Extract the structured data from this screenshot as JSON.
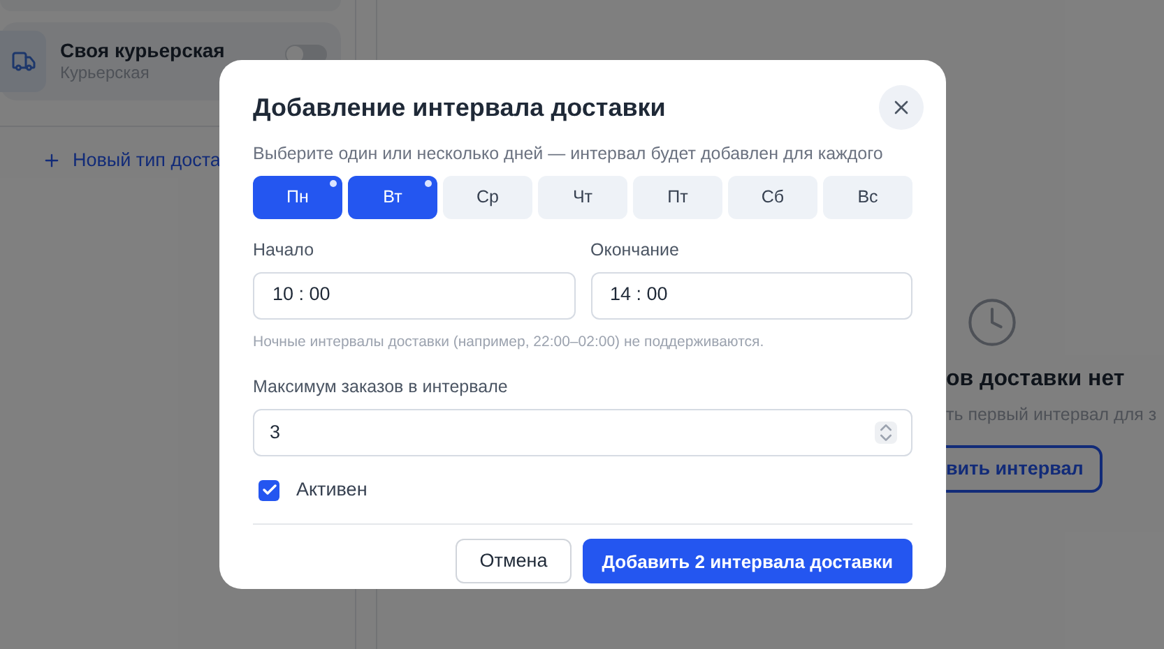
{
  "sidebar": {
    "items": [
      {
        "title": "Своя курьерская",
        "subtitle": "Курьерская",
        "on": false
      }
    ],
    "add_link": "Новый тип доста"
  },
  "empty_state": {
    "title": "ов доставки нет",
    "subtitle": "ть первый интервал для з",
    "button": "вить интервал"
  },
  "dialog": {
    "title": "Добавление интервала доставки",
    "hint": "Выберите один или несколько дней — интервал будет добавлен для каждого",
    "days": [
      {
        "label": "Пн",
        "selected": true
      },
      {
        "label": "Вт",
        "selected": true
      },
      {
        "label": "Ср",
        "selected": false
      },
      {
        "label": "Чт",
        "selected": false
      },
      {
        "label": "Пт",
        "selected": false
      },
      {
        "label": "Сб",
        "selected": false
      },
      {
        "label": "Вс",
        "selected": false
      }
    ],
    "start": {
      "label": "Начало",
      "value": "10 : 00"
    },
    "end": {
      "label": "Окончание",
      "value": "14 : 00"
    },
    "note": "Ночные интервалы доставки (например, 22:00–02:00) не поддерживаются.",
    "max_orders": {
      "label": "Максимум заказов в интервале",
      "value": "3"
    },
    "active": {
      "label": "Активен",
      "checked": true
    },
    "buttons": {
      "cancel": "Отмена",
      "submit": "Добавить 2 интервала доставки"
    }
  }
}
